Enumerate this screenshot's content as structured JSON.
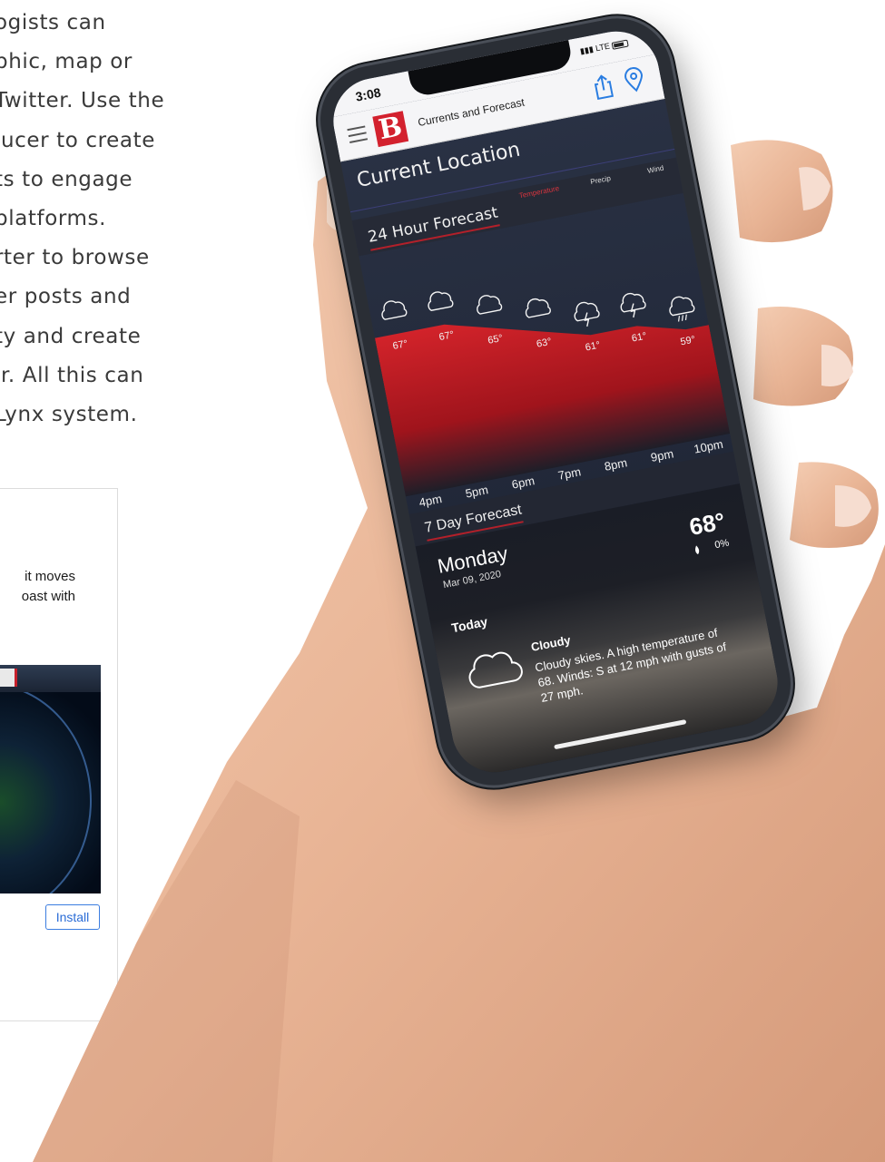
{
  "marketing": {
    "lines": [
      "ogists can",
      "phic, map or",
      "Twitter. Use the",
      "lucer to create",
      "ts to engage",
      " platforms.",
      "rter to browse",
      "er posts and",
      "ty and create",
      "ir. All this can",
      "Lynx system."
    ]
  },
  "card": {
    "desc_line1": "it moves",
    "desc_line2": "oast with",
    "install_label": "Install"
  },
  "status_bar": {
    "time": "3:08",
    "carrier": "LTE"
  },
  "header": {
    "title": "Currents and Forecast",
    "logo_letter": "B"
  },
  "location": {
    "title": "Current Location"
  },
  "hourly": {
    "title": "24 Hour Forecast",
    "tabs": [
      "Temperature",
      "Precip",
      "Wind"
    ],
    "active_tab": "Temperature",
    "hours": [
      "4pm",
      "5pm",
      "6pm",
      "7pm",
      "8pm",
      "9pm",
      "10pm"
    ],
    "icons": [
      "cloud-icon",
      "cloud-icon",
      "cloud-icon",
      "cloud-icon",
      "thunderstorm-icon",
      "thunderstorm-icon",
      "rain-icon"
    ]
  },
  "chart_data": {
    "type": "area",
    "x": [
      "4pm",
      "5pm",
      "6pm",
      "7pm",
      "8pm",
      "9pm",
      "10pm"
    ],
    "series": [
      {
        "values": [
          67,
          67,
          65,
          63,
          61,
          61,
          59
        ]
      }
    ],
    "value_labels": [
      "67°",
      "67°",
      "65°",
      "63°",
      "61°",
      "61°",
      "59°"
    ],
    "fill_color": "#b8161e"
  },
  "weekly": {
    "title": "7 Day Forecast",
    "day": "Monday",
    "date": "Mar 09, 2020",
    "high": "68°",
    "precip": "0%",
    "today_label": "Today",
    "condition": "Cloudy",
    "description_lines": [
      "Cloudy skies.  A high temperature of",
      "68.  Winds: S at 12 mph with gusts of",
      "27 mph."
    ]
  },
  "colors": {
    "brand_red": "#d3212e",
    "accent_red": "#b3202a",
    "link_blue": "#2a6cd6"
  }
}
